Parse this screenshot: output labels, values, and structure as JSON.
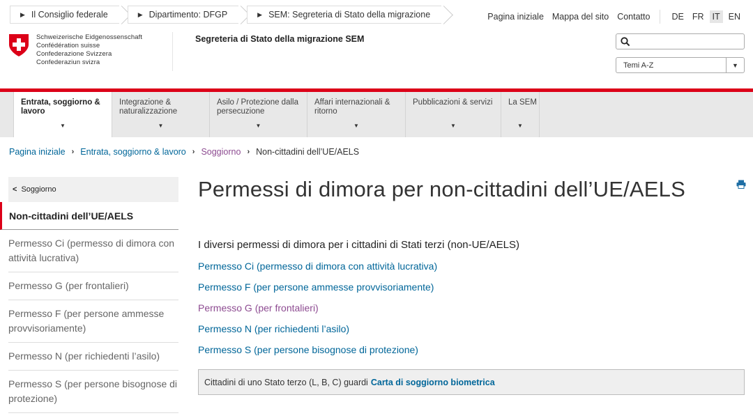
{
  "top": {
    "departments": [
      "Il Consiglio federale",
      "Dipartimento: DFGP",
      "SEM: Segreteria di Stato della migrazione"
    ],
    "links": [
      "Pagina iniziale",
      "Mappa del sito",
      "Contatto"
    ],
    "languages": [
      "DE",
      "FR",
      "IT",
      "EN"
    ],
    "active_language": "IT"
  },
  "header": {
    "federation_lines": [
      "Schweizerische Eidgenossenschaft",
      "Confédération suisse",
      "Confederazione Svizzera",
      "Confederaziun svizra"
    ],
    "site_title": "Segreteria di Stato della migrazione SEM",
    "search_placeholder": "",
    "topics_select": "Temi A-Z"
  },
  "nav": {
    "items": [
      {
        "label": "Entrata, soggiorno & lavoro"
      },
      {
        "label": "Integrazione & naturalizzazione"
      },
      {
        "label": "Asilo / Protezione dalla persecuzione"
      },
      {
        "label": "Affari internazionali & ritorno"
      },
      {
        "label": "Pubblicazioni & servizi"
      },
      {
        "label": "La SEM"
      }
    ]
  },
  "breadcrumb": [
    "Pagina iniziale",
    "Entrata, soggiorno & lavoro",
    "Soggiorno",
    "Non-cittadini dell’UE/AELS"
  ],
  "sidebar": {
    "back": "Soggiorno",
    "active": "Non-cittadini dell’UE/AELS",
    "items": [
      "Permesso Ci (permesso di dimora con attività lucrativa)",
      "Permesso G (per frontalieri)",
      "Permesso F (per persone ammesse provvisoriamente)",
      "Permesso N (per richiedenti l’asilo)",
      "Permesso S (per persone bisognose di protezione)"
    ]
  },
  "main": {
    "title": "Permessi di dimora per non-cittadini dell’UE/AELS",
    "section_heading": "I diversi permessi di dimora per i cittadini di Stati terzi (non-UE/AELS)",
    "links": [
      "Permesso Ci (permesso di dimora con attività lucrativa)",
      "Permesso F (per persone ammesse provvisoriamente)",
      "Permesso G (per frontalieri)",
      "Permesso N (per richiedenti l’asilo)",
      "Permesso S (per persone bisognose di protezione)"
    ],
    "info_text": "Cittadini di uno Stato terzo (L, B, C) guardi",
    "info_link": "Carta di soggiorno biometrica"
  },
  "colors": {
    "accent_red": "#dc0018",
    "link_blue": "#006699",
    "visited_purple": "#8d4b91"
  },
  "icons": {
    "print": "print-icon",
    "search": "search-icon",
    "shield": "swiss-shield-icon"
  }
}
